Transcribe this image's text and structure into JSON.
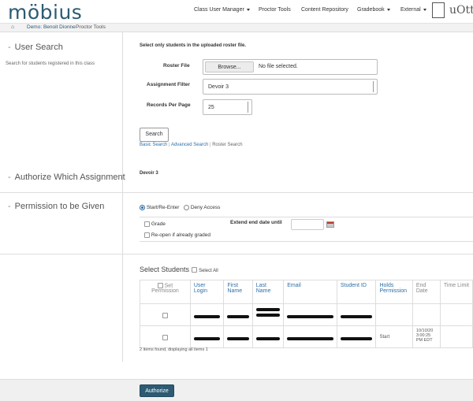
{
  "app": {
    "logo_text": "möbius"
  },
  "nav": [
    {
      "label": "Class User Manager",
      "has_caret": true
    },
    {
      "label": "Proctor Tools",
      "has_caret": false
    },
    {
      "label": "Content Repository",
      "has_caret": false
    },
    {
      "label": "Gradebook",
      "has_caret": true
    },
    {
      "label": "External",
      "has_caret": true
    }
  ],
  "institution": {
    "text": "uOtta"
  },
  "breadcrumb": {
    "home_icon": "home-icon",
    "items": [
      "Demo: Benoit Dionne",
      "Proctor Tools"
    ],
    "separator": "/"
  },
  "user_search": {
    "title": "User Search",
    "subtitle": "Search for students registered in this class",
    "instruction": "Select only students in the uploaded roster file.",
    "roster_label": "Roster File",
    "browse_label": "Browse...",
    "file_status": "No file selected.",
    "assignment_label": "Assignment Filter",
    "assignment_value": "Devoir 3",
    "records_label": "Records Per Page",
    "records_value": "25",
    "search_button": "Search",
    "links": [
      "Basic Search",
      "Advanced Search",
      "Roster Search"
    ],
    "link_separator": "|"
  },
  "authorize_assignment": {
    "title": "Authorize Which Assignment",
    "value": "Devoir 3"
  },
  "permission": {
    "title": "Permission to be Given",
    "radio_start": "Start/Re-Enter",
    "radio_deny": "Deny Access",
    "grade_label": "Grade",
    "reopen_label": "Re-open if already graded",
    "extend_label": "Extend end date until"
  },
  "students": {
    "title": "Select Students",
    "select_all": "Select All",
    "columns": [
      "Set Permission",
      "User Login",
      "First Name",
      "Last Name",
      "Email",
      "Student ID",
      "Holds Permission",
      "End Date",
      "Time Limit"
    ],
    "rows": [
      {
        "holds_permission": "",
        "end_date": ""
      },
      {
        "holds_permission": "Start",
        "end_date": "10/10/20 3:00:25 PM EDT"
      }
    ],
    "footer_note": "2 items found, displaying all items 1"
  },
  "footer": {
    "authorize_button": "Authorize"
  },
  "colors": {
    "brand": "#2c5b73",
    "link": "#2c6fa8"
  }
}
